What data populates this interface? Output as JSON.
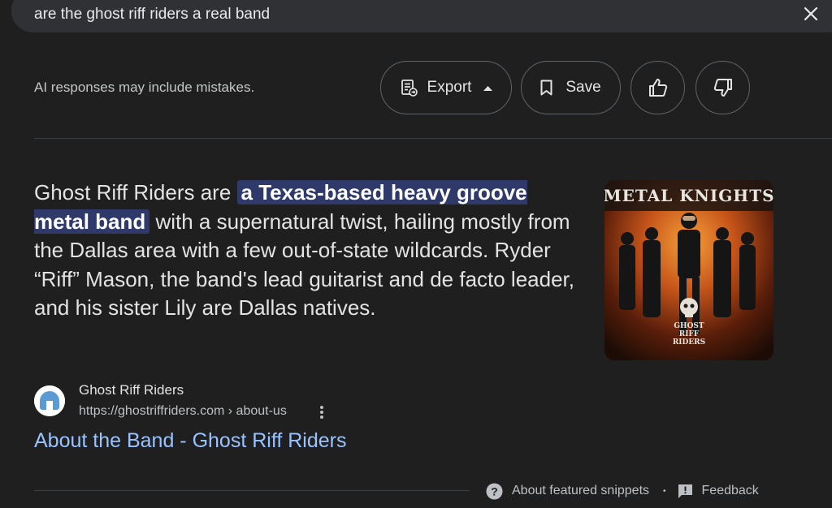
{
  "search": {
    "query": "are the ghost riff riders a real band"
  },
  "toolbar": {
    "disclaimer": "AI responses may include mistakes.",
    "export_label": "Export",
    "save_label": "Save"
  },
  "answer": {
    "before": "Ghost Riff Riders are ",
    "highlight": "a Texas-based heavy groove metal band",
    "after": " with a supernatural twist, hailing mostly from the Dallas area with a few out-of-state wildcards. Ryder “Riff” Mason, the band's lead guitarist and de facto leader, and his sister Lily are Dallas natives."
  },
  "thumbnail": {
    "title": "METAL KNIGHTS",
    "logo_line1": "GHOST",
    "logo_line2": "RIFF",
    "logo_line3": "RIDERS"
  },
  "source": {
    "name": "Ghost Riff Riders",
    "url": "https://ghostriffriders.com › about-us",
    "link_title": "About the Band - Ghost Riff Riders"
  },
  "footer": {
    "about_label": "About featured snippets",
    "separator": "•",
    "feedback_label": "Feedback"
  },
  "colors": {
    "background": "#1f1f1f",
    "highlight_bg": "#2f3a6b",
    "link": "#99c3ff"
  }
}
